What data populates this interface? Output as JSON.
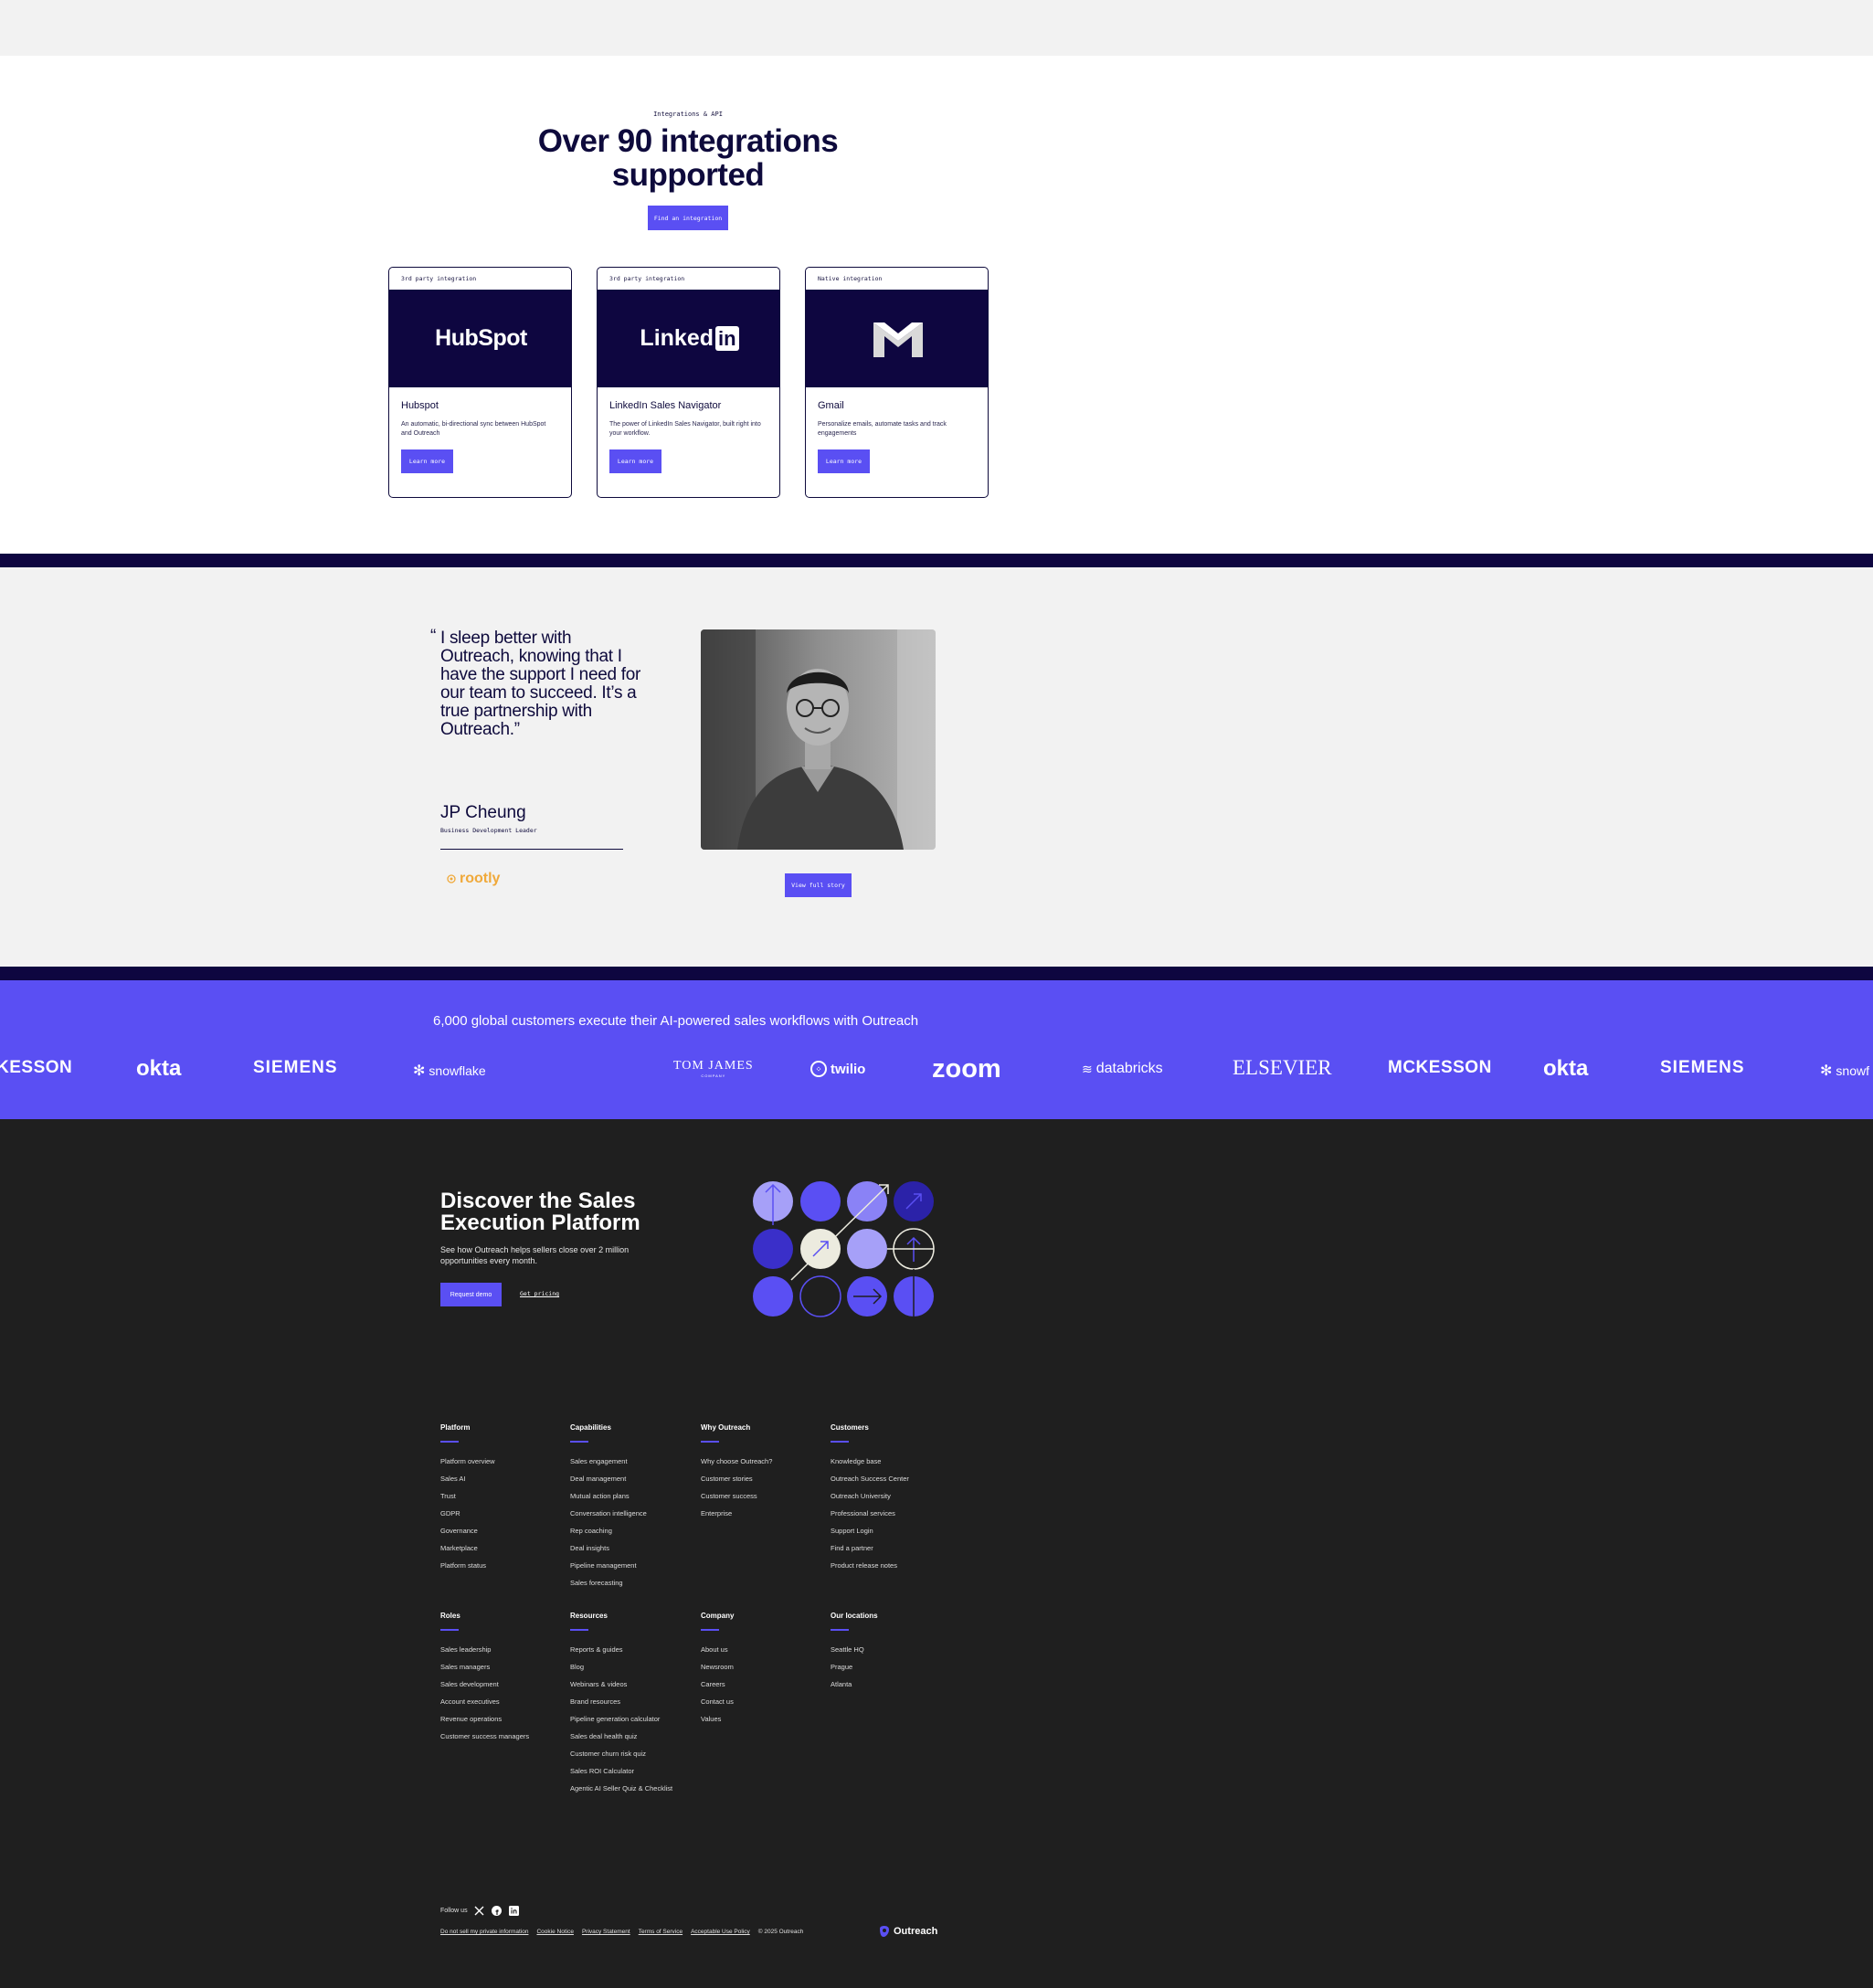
{
  "integrations": {
    "eyebrow": "Integrations & API",
    "title": "Over 90 integrations supported",
    "cta": "Find an integration",
    "cards": [
      {
        "tag": "3rd party integration",
        "logo": "HubSpot",
        "name": "Hubspot",
        "desc": "An automatic, bi-directional sync between HubSpot and Outreach",
        "btn": "Learn more"
      },
      {
        "tag": "3rd party integration",
        "logo": "Linked",
        "logo_badge": "in",
        "name": "LinkedIn Sales Navigator",
        "desc": "The power of LinkedIn Sales Navigator, built right into your workflow.",
        "btn": "Learn more"
      },
      {
        "tag": "Native integration",
        "logo": "gmail-icon",
        "name": "Gmail",
        "desc": "Personalize emails, automate tasks and track engagements",
        "btn": "Learn more"
      }
    ]
  },
  "testimonial": {
    "quote_open": "“",
    "quote": "I sleep better with Outreach, knowing that I have the support I need for our team to succeed. It’s a true partnership with Outreach.”",
    "person": "JP Cheung",
    "role": "Business Development Leader",
    "company": "rootly",
    "cta": "View full story"
  },
  "customers": {
    "text": "6,000 global customers execute their AI-powered sales workflows with Outreach",
    "logos": [
      "KESSON",
      "okta",
      "SIEMENS",
      "snowflake",
      "TOM JAMES",
      "twilio",
      "zoom",
      "databricks",
      "ELSEVIER",
      "MCKESSON",
      "okta",
      "SIEMENS",
      "snowf"
    ],
    "tomjames_sub": "COMPANY"
  },
  "footer": {
    "cta_title": "Discover the Sales Execution Platform",
    "cta_desc": "See how Outreach helps sellers close over 2 million opportunities every month.",
    "demo": "Request demo",
    "pricing": "Get pricing",
    "columns": [
      {
        "title": "Platform",
        "links": [
          "Platform overview",
          "Sales AI",
          "Trust",
          "GDPR",
          "Governance",
          "Marketplace",
          "Platform status"
        ]
      },
      {
        "title": "Capabilities",
        "links": [
          "Sales engagement",
          "Deal management",
          "Mutual action plans",
          "Conversation intelligence",
          "Rep coaching",
          "Deal insights",
          "Pipeline management",
          "Sales forecasting"
        ]
      },
      {
        "title": "Why Outreach",
        "links": [
          "Why choose Outreach?",
          "Customer stories",
          "Customer success",
          "Enterprise"
        ]
      },
      {
        "title": "Customers",
        "links": [
          "Knowledge base",
          "Outreach Success Center",
          "Outreach University",
          "Professional services",
          "Support Login",
          "Find a partner",
          "Product release notes"
        ]
      },
      {
        "title": "Roles",
        "links": [
          "Sales leadership",
          "Sales managers",
          "Sales development",
          "Account executives",
          "Revenue operations",
          "Customer success managers"
        ]
      },
      {
        "title": "Resources",
        "links": [
          "Reports & guides",
          "Blog",
          "Webinars & videos",
          "Brand resources",
          "Pipeline generation calculator",
          "Sales deal health quiz",
          "Customer churn risk quiz",
          "Sales ROI Calculator",
          "Agentic AI Seller Quiz & Checklist"
        ]
      },
      {
        "title": "Company",
        "links": [
          "About us",
          "Newsroom",
          "Careers",
          "Contact us",
          "Values"
        ]
      },
      {
        "title": "Our locations",
        "links": [
          "Seattle HQ",
          "Prague",
          "Atlanta"
        ]
      }
    ],
    "follow": "Follow us",
    "legal": [
      "Do not sell my private information",
      "Cookie Notice",
      "Privacy Statement",
      "Terms of Service",
      "Acceptable Use Policy"
    ],
    "copyright": "© 2025 Outreach",
    "brand": "Outreach"
  },
  "colors": {
    "accent": "#5a4ff3",
    "navy": "#0e0640",
    "footer_bg": "#1f1f1f"
  }
}
